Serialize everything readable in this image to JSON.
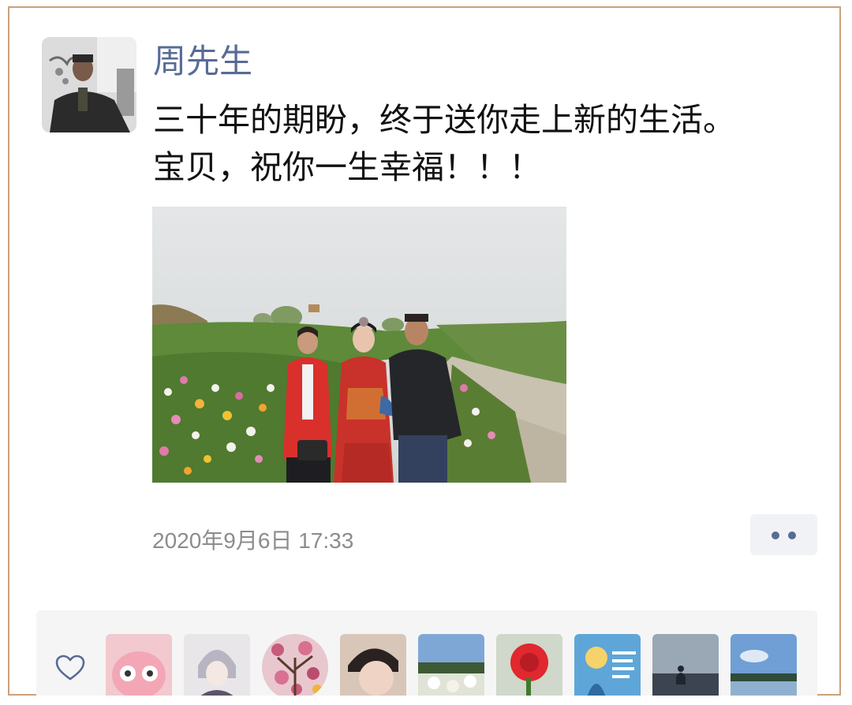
{
  "post": {
    "author": "周先生",
    "text_lines": [
      "三十年的期盼，终于送你走上新的生活。",
      "宝贝，祝你一生幸福！！！"
    ],
    "timestamp": "2020年9月6日 17:33"
  },
  "icons": {
    "more": "more-dots-icon",
    "like": "heart-outline-icon"
  },
  "colors": {
    "author_name": "#576b95",
    "frame_border": "#c9a27a",
    "likes_bg": "#f5f5f5"
  },
  "likes": {
    "liker_avatar_count": 9
  }
}
